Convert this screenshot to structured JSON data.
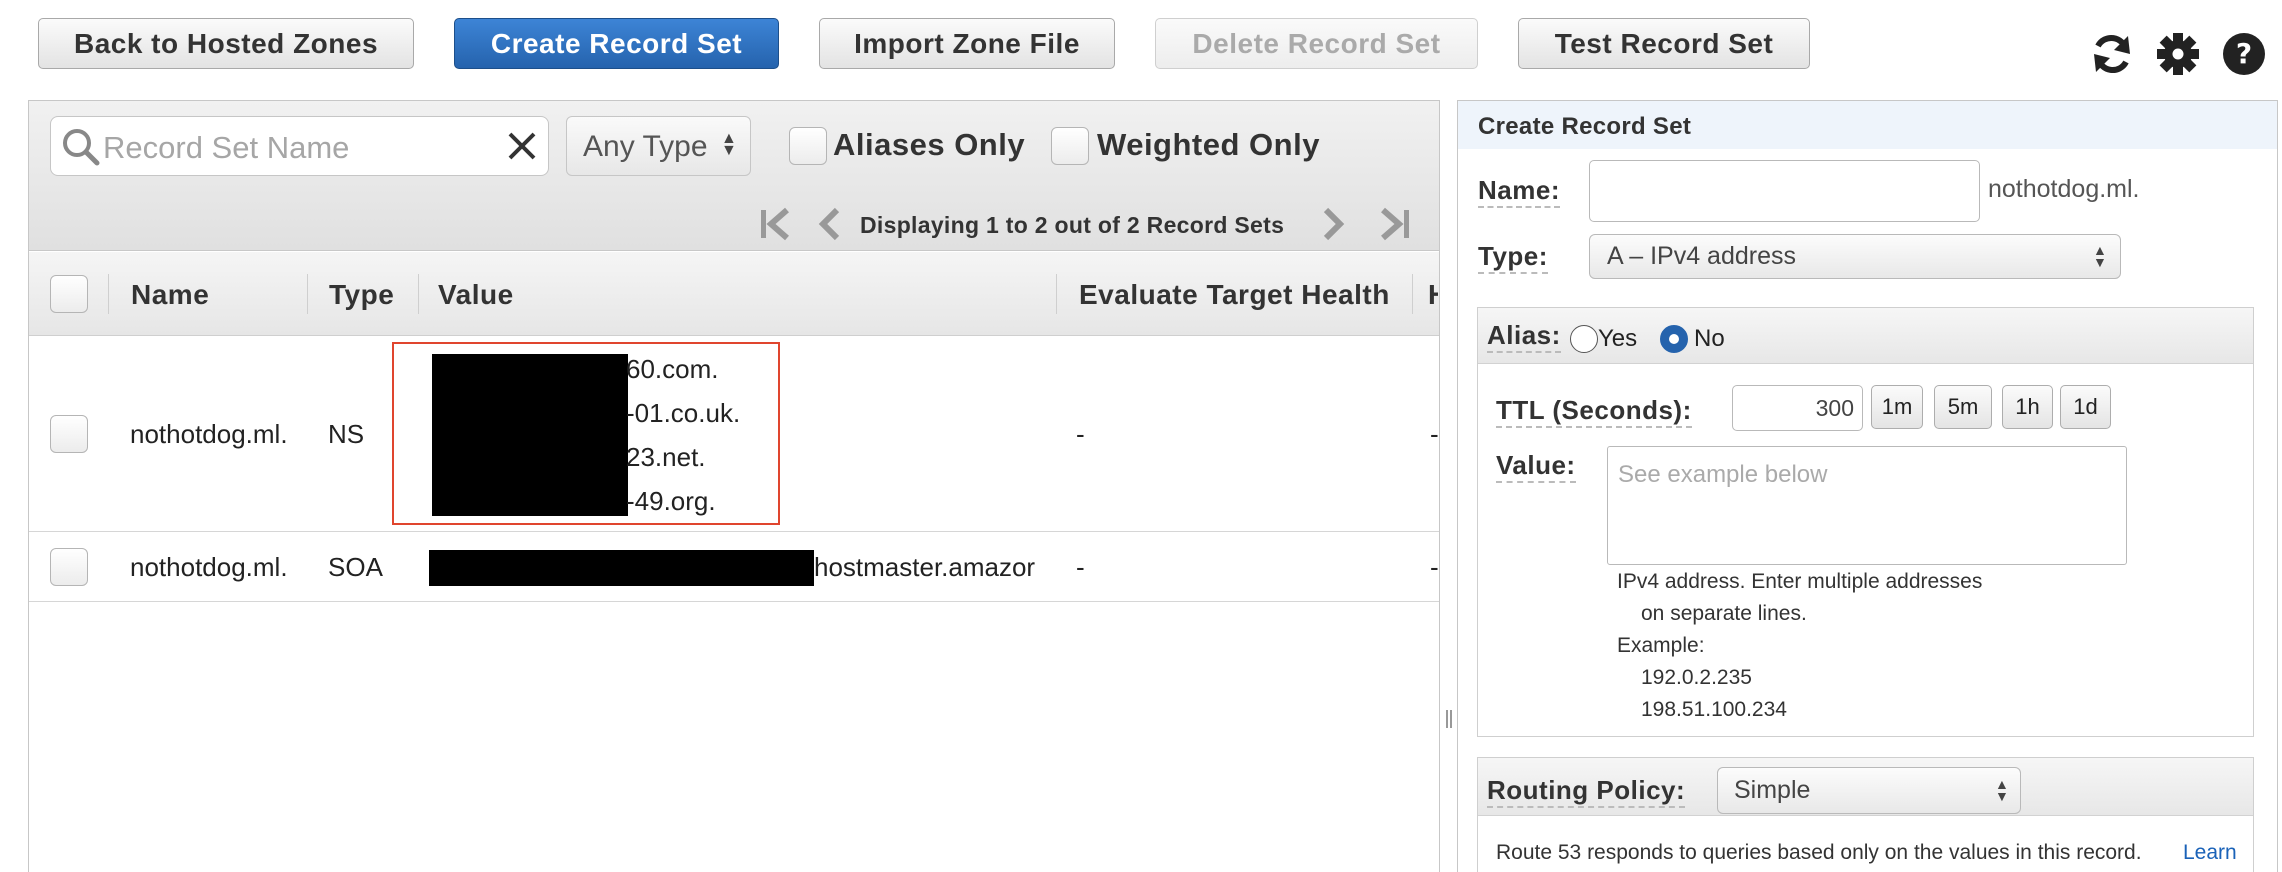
{
  "toolbar": {
    "back": "Back to Hosted Zones",
    "create": "Create Record Set",
    "import": "Import Zone File",
    "delete": "Delete Record Set",
    "test": "Test Record Set"
  },
  "filters": {
    "search_placeholder": "Record Set Name",
    "type_value": "Any Type",
    "aliases_only": "Aliases Only",
    "weighted_only": "Weighted Only"
  },
  "pager": {
    "text": "Displaying 1 to 2 out of 2 Record Sets"
  },
  "table": {
    "columns": [
      "Name",
      "Type",
      "Value",
      "Evaluate Target Health",
      "H"
    ],
    "rows": [
      {
        "name": "nothotdog.ml.",
        "type": "NS",
        "values": [
          "60.com.",
          "-01.co.uk.",
          "23.net.",
          "-49.org."
        ],
        "evaluate": "-",
        "extra": "-"
      },
      {
        "name": "nothotdog.ml.",
        "type": "SOA",
        "value": "hostmaster.amazor",
        "evaluate": "-",
        "extra": "-"
      }
    ]
  },
  "form": {
    "title": "Create Record Set",
    "name_label": "Name:",
    "name_suffix": "nothotdog.ml.",
    "type_label": "Type:",
    "type_value": "A – IPv4 address",
    "alias_label": "Alias:",
    "alias_yes": "Yes",
    "alias_no": "No",
    "ttl_label": "TTL (Seconds):",
    "ttl_value": "300",
    "ttl_buttons": [
      "1m",
      "5m",
      "1h",
      "1d"
    ],
    "value_label": "Value:",
    "value_placeholder": "See example below",
    "hint_line1": "IPv4 address. Enter multiple addresses",
    "hint_line2": "on separate lines.",
    "hint_example": "Example:",
    "hint_ip1": "192.0.2.235",
    "hint_ip2": "198.51.100.234",
    "routing_label": "Routing Policy:",
    "routing_value": "Simple",
    "routing_desc": "Route 53 responds to queries based only on the values in this record.",
    "learn": "Learn"
  },
  "colors": {
    "primary": "#2563ad",
    "redaction_border": "#e0452e",
    "link": "#1a62b8"
  },
  "icons": [
    "refresh-icon",
    "gear-icon",
    "help-icon",
    "search-icon",
    "clear-icon",
    "first-page-icon",
    "prev-page-icon",
    "next-page-icon",
    "last-page-icon"
  ]
}
